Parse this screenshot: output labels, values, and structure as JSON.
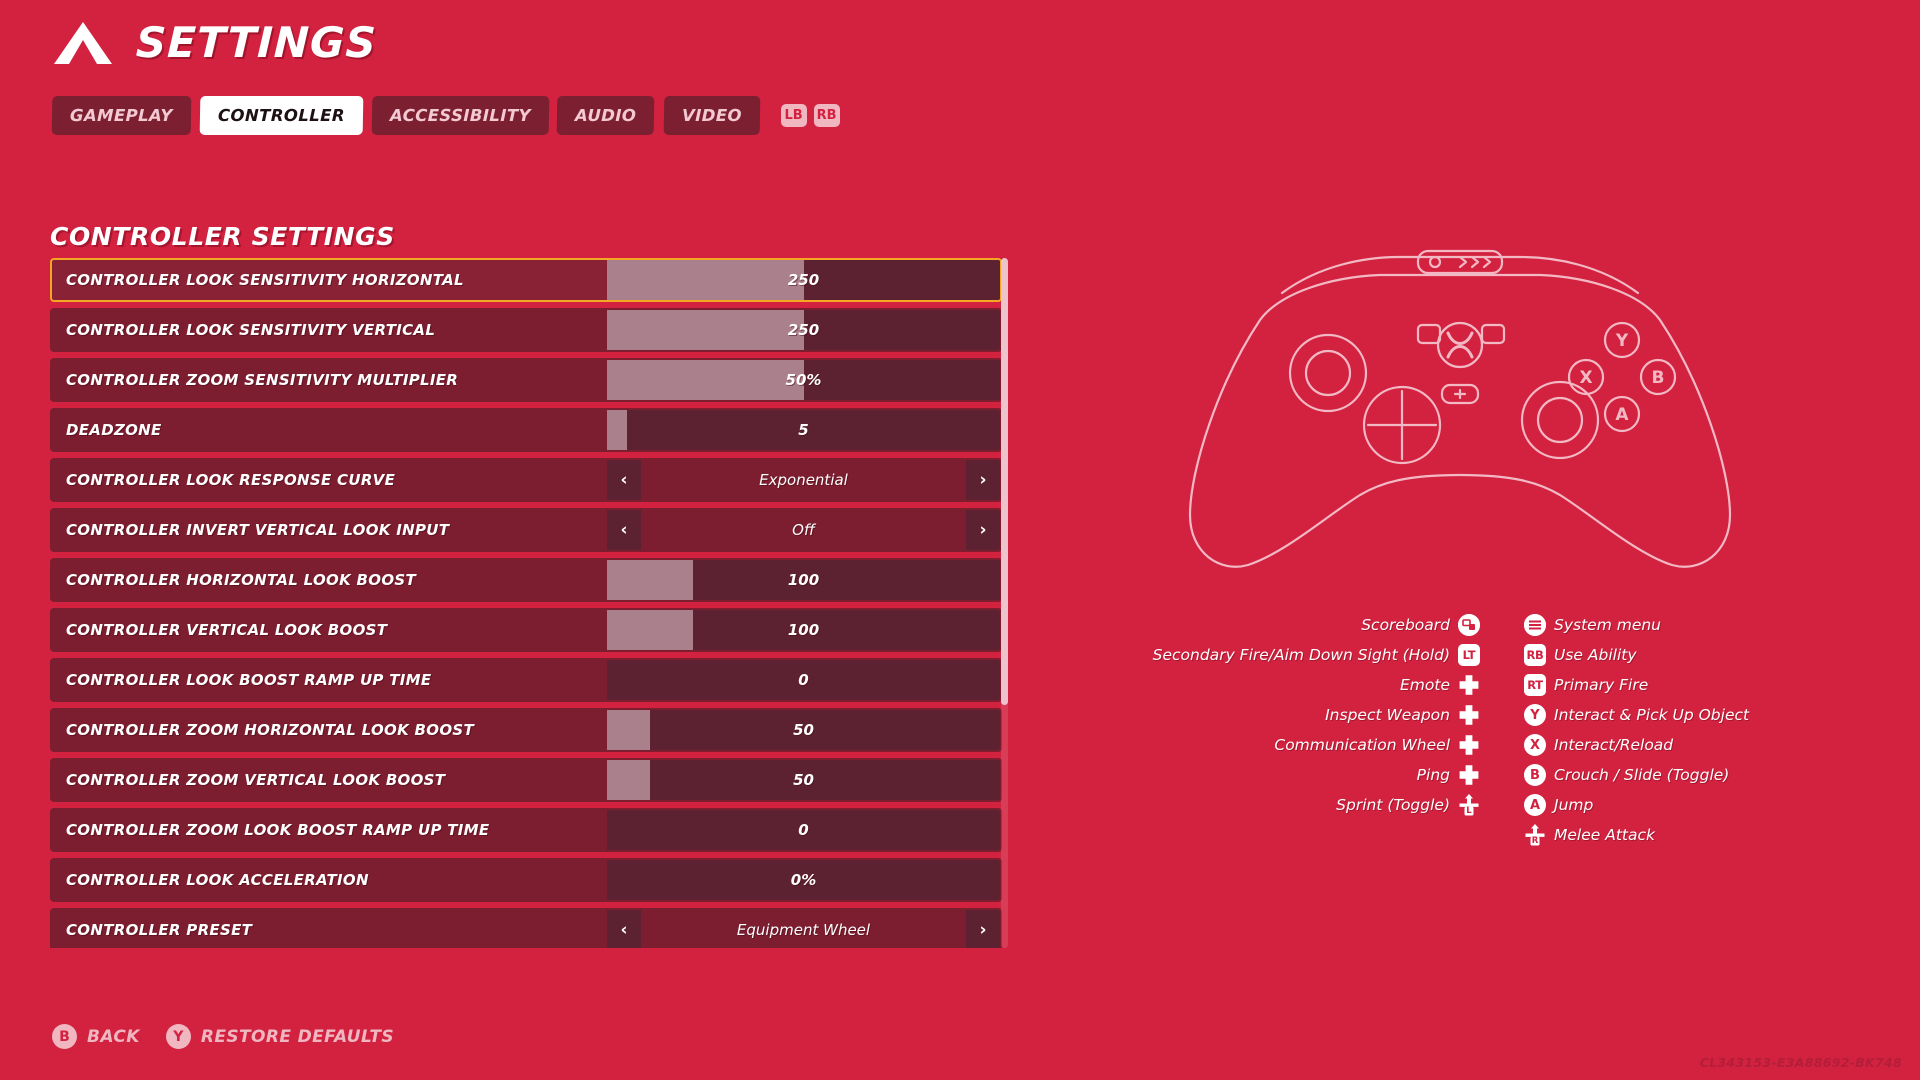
{
  "theme": {
    "background": "#d32140",
    "row_bg": "#7d1e30",
    "row_selected_border": "#f5a623",
    "slider_fill": "#a9808c",
    "slider_track": "#5d2232",
    "accent_light": "#f0b7c1"
  },
  "header": {
    "title": "SETTINGS",
    "logo_icon": "apex-triangle-logo"
  },
  "tabs": [
    {
      "label": "GAMEPLAY",
      "active": false
    },
    {
      "label": "CONTROLLER",
      "active": true
    },
    {
      "label": "ACCESSIBILITY",
      "active": false
    },
    {
      "label": "AUDIO",
      "active": false
    },
    {
      "label": "VIDEO",
      "active": false
    }
  ],
  "tab_bumpers": [
    {
      "label": "LB",
      "icon": "left-bumper-icon"
    },
    {
      "label": "RB",
      "icon": "right-bumper-icon"
    }
  ],
  "section": {
    "title": "CONTROLLER SETTINGS"
  },
  "settings": [
    {
      "label": "CONTROLLER LOOK SENSITIVITY HORIZONTAL",
      "type": "slider",
      "value": "250",
      "fill_pct": 50,
      "selected": true
    },
    {
      "label": "CONTROLLER LOOK SENSITIVITY VERTICAL",
      "type": "slider",
      "value": "250",
      "fill_pct": 50,
      "selected": false
    },
    {
      "label": "CONTROLLER ZOOM SENSITIVITY MULTIPLIER",
      "type": "slider",
      "value": "50%",
      "fill_pct": 50,
      "selected": false
    },
    {
      "label": "DEADZONE",
      "type": "slider",
      "value": "5",
      "fill_pct": 5,
      "selected": false
    },
    {
      "label": "CONTROLLER LOOK RESPONSE CURVE",
      "type": "stepper",
      "value": "Exponential",
      "left_arrow": "‹",
      "right_arrow": "›",
      "selected": false
    },
    {
      "label": "CONTROLLER INVERT VERTICAL LOOK INPUT",
      "type": "stepper",
      "value": "Off",
      "left_arrow": "‹",
      "right_arrow": "›",
      "selected": false
    },
    {
      "label": "CONTROLLER HORIZONTAL LOOK BOOST",
      "type": "slider",
      "value": "100",
      "fill_pct": 22,
      "selected": false
    },
    {
      "label": "CONTROLLER VERTICAL LOOK BOOST",
      "type": "slider",
      "value": "100",
      "fill_pct": 22,
      "selected": false
    },
    {
      "label": "CONTROLLER LOOK BOOST RAMP UP TIME",
      "type": "slider",
      "value": "0",
      "fill_pct": 0,
      "selected": false
    },
    {
      "label": "CONTROLLER ZOOM HORIZONTAL LOOK BOOST",
      "type": "slider",
      "value": "50",
      "fill_pct": 11,
      "selected": false
    },
    {
      "label": "CONTROLLER ZOOM VERTICAL LOOK BOOST",
      "type": "slider",
      "value": "50",
      "fill_pct": 11,
      "selected": false
    },
    {
      "label": "CONTROLLER ZOOM LOOK BOOST RAMP UP TIME",
      "type": "slider",
      "value": "0",
      "fill_pct": 0,
      "selected": false
    },
    {
      "label": "CONTROLLER LOOK ACCELERATION",
      "type": "slider",
      "value": "0%",
      "fill_pct": 0,
      "selected": false
    },
    {
      "label": "CONTROLLER PRESET",
      "type": "stepper",
      "value": "Equipment Wheel",
      "left_arrow": "‹",
      "right_arrow": "›",
      "selected": false
    }
  ],
  "controller_diagram": {
    "icon": "xbox-controller-outline"
  },
  "legend_left": [
    {
      "text": "Scoreboard",
      "glyph": "view-button-icon",
      "glyph_label": "",
      "shape": "round"
    },
    {
      "text": "Secondary Fire/Aim Down Sight (Hold)",
      "glyph": "left-trigger-icon",
      "glyph_label": "LT",
      "shape": "rect"
    },
    {
      "text": "Emote",
      "glyph": "dpad-up-icon",
      "glyph_label": "",
      "shape": "dpad"
    },
    {
      "text": "Inspect Weapon",
      "glyph": "dpad-right-icon",
      "glyph_label": "",
      "shape": "dpad"
    },
    {
      "text": "Communication Wheel",
      "glyph": "dpad-left-icon",
      "glyph_label": "",
      "shape": "dpad"
    },
    {
      "text": "Ping",
      "glyph": "dpad-right-icon",
      "glyph_label": "",
      "shape": "dpad"
    },
    {
      "text": "Sprint (Toggle)",
      "glyph": "left-stick-press-icon",
      "glyph_label": "L",
      "shape": "stick"
    }
  ],
  "legend_right": [
    {
      "text": "System menu",
      "glyph": "menu-button-icon",
      "glyph_label": "",
      "shape": "round"
    },
    {
      "text": "Use Ability",
      "glyph": "right-bumper-icon",
      "glyph_label": "RB",
      "shape": "rect"
    },
    {
      "text": "Primary Fire",
      "glyph": "right-trigger-icon",
      "glyph_label": "RT",
      "shape": "rect"
    },
    {
      "text": "Interact & Pick Up Object",
      "glyph": "y-button-icon",
      "glyph_label": "Y",
      "shape": "round"
    },
    {
      "text": "Interact/Reload",
      "glyph": "x-button-icon",
      "glyph_label": "X",
      "shape": "round"
    },
    {
      "text": "Crouch / Slide (Toggle)",
      "glyph": "b-button-icon",
      "glyph_label": "B",
      "shape": "round"
    },
    {
      "text": "Jump",
      "glyph": "a-button-icon",
      "glyph_label": "A",
      "shape": "round"
    },
    {
      "text": "Melee Attack",
      "glyph": "right-stick-press-icon",
      "glyph_label": "R",
      "shape": "stick"
    }
  ],
  "footer": [
    {
      "badge": "B",
      "label": "BACK",
      "icon": "b-button-icon"
    },
    {
      "badge": "Y",
      "label": "RESTORE DEFAULTS",
      "icon": "y-button-icon"
    }
  ],
  "build_id": "CL343153-E3A88692-BK748"
}
